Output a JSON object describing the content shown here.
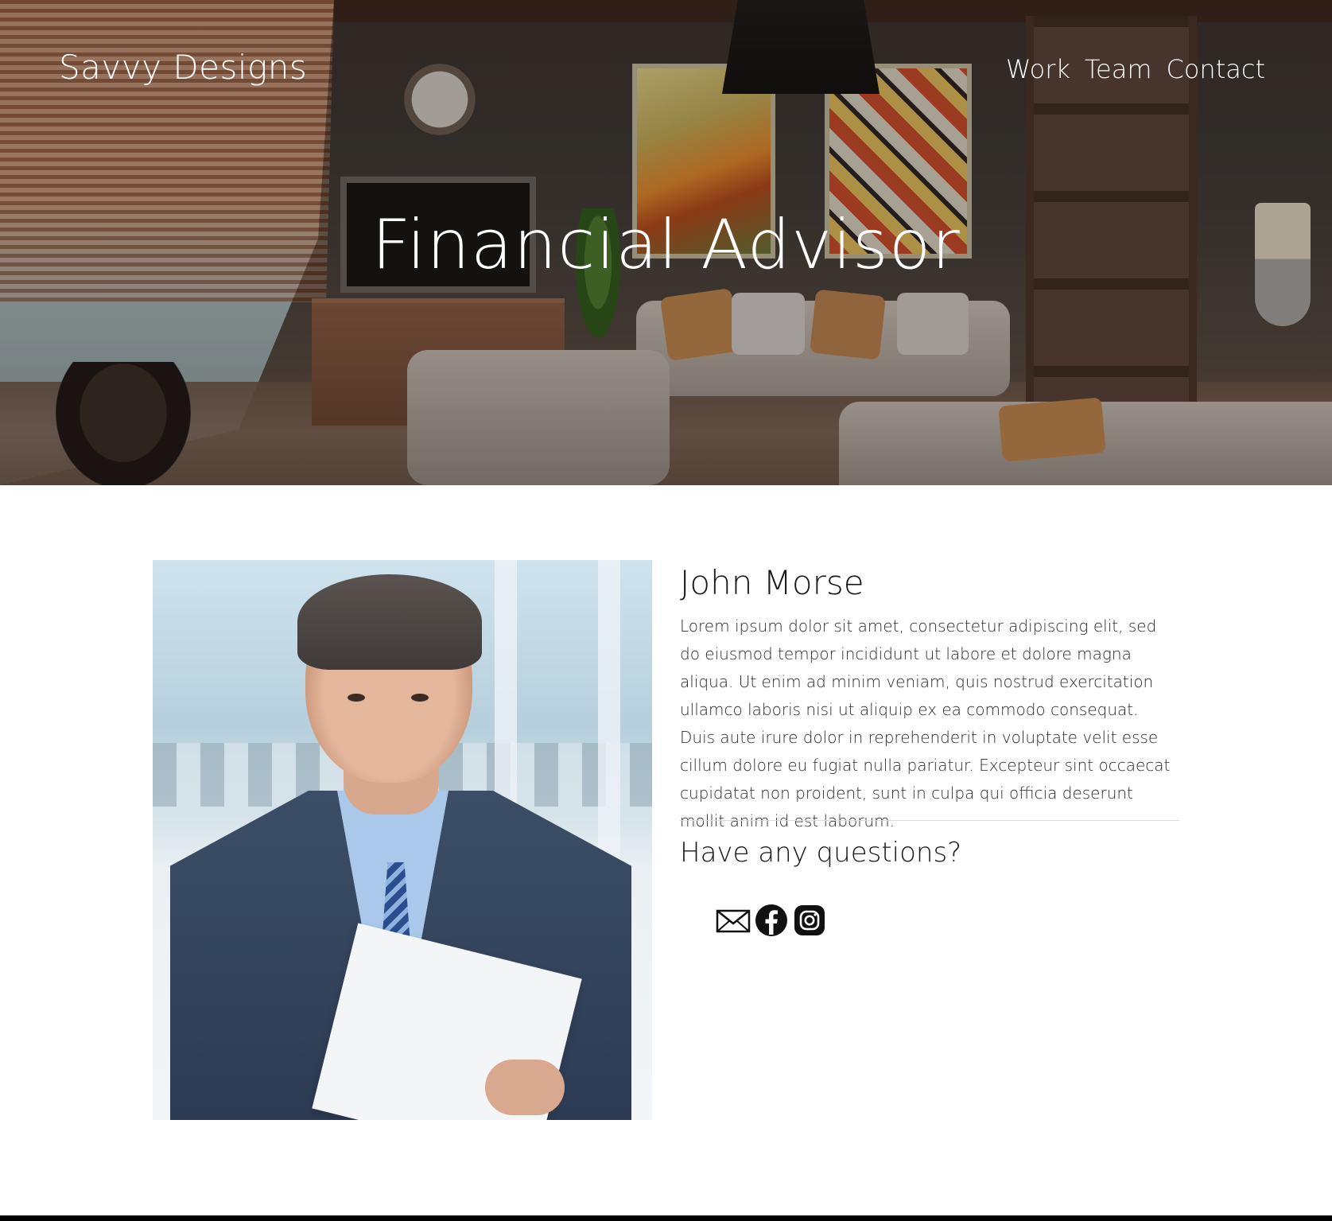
{
  "header": {
    "brand": "Savvy Designs",
    "nav": [
      {
        "label": "Work"
      },
      {
        "label": "Team"
      },
      {
        "label": "Contact"
      }
    ]
  },
  "hero": {
    "title": "Financial Advisor"
  },
  "profile": {
    "name": "John Morse",
    "bio": "Lorem ipsum dolor sit amet, consectetur adipiscing elit, sed do eiusmod tempor incididunt ut labore et dolore magna aliqua. Ut enim ad minim veniam, quis nostrud exercitation ullamco laboris nisi ut aliquip ex ea commodo consequat. Duis aute irure dolor in reprehenderit in voluptate velit esse cillum dolore eu fugiat nulla pariatur. Excepteur sint occaecat cupidatat non proident, sunt in culpa qui officia deserunt mollit anim id est laborum.",
    "questions": "Have any questions?",
    "social": [
      {
        "icon": "email-icon"
      },
      {
        "icon": "facebook-icon"
      },
      {
        "icon": "instagram-icon"
      }
    ]
  },
  "colors": {
    "hero_text": "#ffffff",
    "body_text": "#1a1a1a",
    "footer_bar": "#000000"
  }
}
